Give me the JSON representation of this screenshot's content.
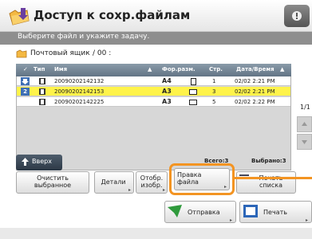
{
  "title": "Доступ к сохр.файлам",
  "status": "Выберите файл и укажите задачу.",
  "mailbox": {
    "label": "Почтовый ящик",
    "number": "/ 00 :"
  },
  "table": {
    "headers": {
      "check": "✓",
      "type": "Тип",
      "name": "Имя",
      "format": "Фор.разм.",
      "pages": "Стр.",
      "datetime": "Дата/Время"
    },
    "rows": [
      {
        "num": "",
        "name": "20090202142132",
        "size": "A4",
        "pages": "1",
        "date": "02/02 2:21 PM",
        "selected": false
      },
      {
        "num": "2",
        "name": "20090202142153",
        "size": "A3",
        "pages": "3",
        "date": "02/02 2:21 PM",
        "selected": true
      },
      {
        "num": "",
        "name": "20090202142225",
        "size": "A3",
        "pages": "5",
        "date": "02/02 2:22 PM",
        "selected": false
      }
    ],
    "total": "Всего:3",
    "selected": "Выбрано:3"
  },
  "up_label": "Вверх",
  "page_indicator": "1/1",
  "buttons": {
    "clear": [
      "Очистить",
      "выбранное"
    ],
    "details": "Детали",
    "display": [
      "Отобр.",
      "изобр."
    ],
    "edit": [
      "Правка",
      "файла"
    ],
    "print_list": [
      "Печать",
      "списка"
    ],
    "send": "Отправка",
    "print": "Печать"
  },
  "colors": {
    "highlight": "#f39422",
    "selected_row": "#fff34a",
    "header": "#6e7f8f"
  }
}
